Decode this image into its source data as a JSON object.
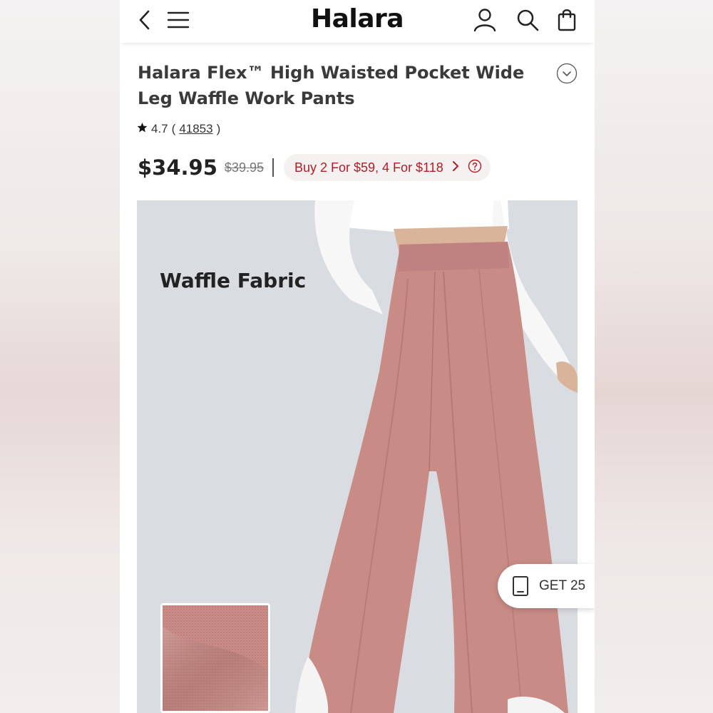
{
  "header": {
    "logo": "Halara",
    "icons": [
      "back-icon",
      "menu-icon",
      "account-icon",
      "search-icon",
      "bag-icon"
    ]
  },
  "product": {
    "title": "Halara Flex™ High Waisted Pocket Wide Leg Waffle Work Pants",
    "rating": "4.7",
    "review_count": "41853",
    "price": "$34.95",
    "original_price": "$39.95",
    "promo": "Buy 2 For $59, 4 For $118"
  },
  "image": {
    "fabric_label": "Waffle Fabric"
  },
  "floating": {
    "get_label": "GET 25"
  },
  "colors": {
    "promo_red": "#b11d27",
    "pants_pink": "#c98b86",
    "image_bg": "#d9dce1"
  }
}
